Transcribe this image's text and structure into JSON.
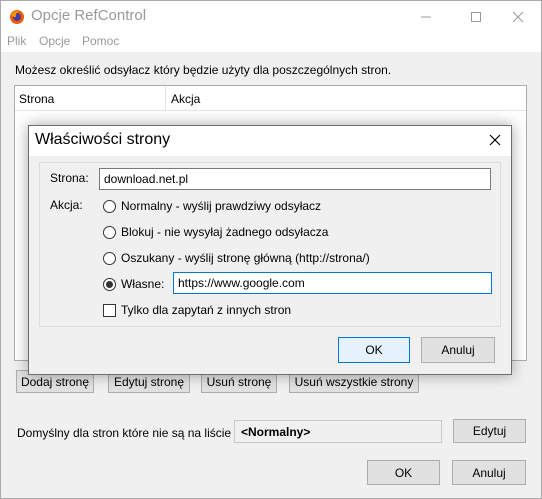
{
  "window": {
    "title": "Opcje RefControl",
    "menu": [
      {
        "label": "Plik"
      },
      {
        "label": "Opcje"
      },
      {
        "label": "Pomoc"
      }
    ],
    "description": "Możesz określić odsyłacz który będzie użyty dla poszczególnych stron.",
    "list": {
      "columns": [
        "Strona",
        "Akcja"
      ],
      "rows": []
    },
    "buttons": {
      "add": "Dodaj stronę",
      "edit": "Edytuj stronę",
      "remove": "Usuń stronę",
      "remove_all": "Usuń wszystkie strony"
    },
    "default": {
      "label": "Domyślny dla stron które nie są na liście",
      "value": "<Normalny>",
      "edit_button": "Edytuj"
    },
    "ok": "OK",
    "cancel": "Anuluj"
  },
  "dialog": {
    "title": "Właściwości strony",
    "site_label": "Strona:",
    "site_value": "download.net.pl",
    "action_label": "Akcja:",
    "options": [
      {
        "label": "Normalny - wyślij prawdziwy odsyłacz",
        "selected": false
      },
      {
        "label": "Blokuj - nie wysyłaj żadnego odsyłacza",
        "selected": false
      },
      {
        "label": "Oszukany - wyślij stronę główną (http://strona/)",
        "selected": false
      },
      {
        "label": "Własne:",
        "selected": true
      }
    ],
    "custom_value": "https://www.google.com",
    "third_party_label": "Tylko dla zapytań z innych stron",
    "third_party_checked": false,
    "ok": "OK",
    "cancel": "Anuluj"
  },
  "colors": {
    "window_bg": "#f0f0f0",
    "focus_border": "#0078d7",
    "disabled_text": "#999999"
  },
  "icons": {
    "app": "firefox-icon",
    "minimize": "minimize-icon",
    "maximize": "maximize-icon",
    "close": "close-icon"
  }
}
